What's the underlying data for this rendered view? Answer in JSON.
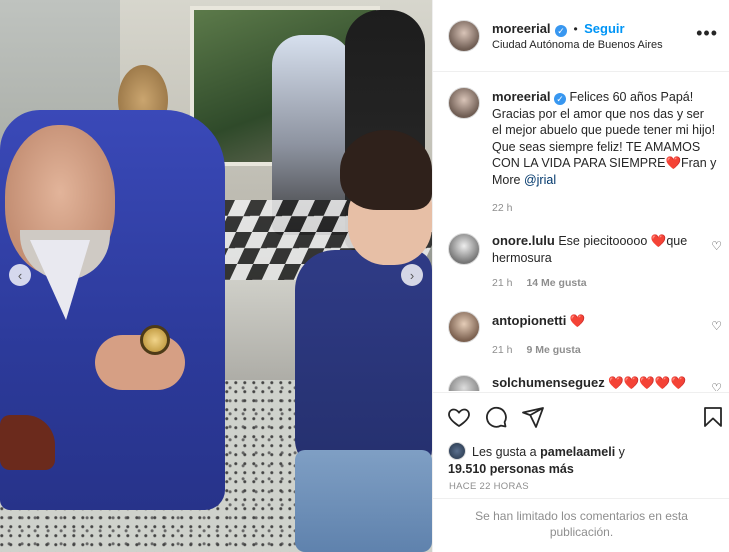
{
  "post": {
    "username": "moreerial",
    "follow_label": "Seguir",
    "location": "Ciudad Autónoma de Buenos Aires",
    "more_label": "•••"
  },
  "caption": {
    "username": "moreerial",
    "text": "Felices 60 años Papá! Gracias por el amor que nos das y ser el mejor abuelo que puede tener mi hijo! Que seas siempre feliz! TE AMAMOS CON LA VIDA PARA SIEMPRE❤️Fran y More",
    "mention": "@jrial",
    "time": "22 h"
  },
  "comments": [
    {
      "username": "onore.lulu",
      "text": "Ese piecitooooo ❤️que hermosura",
      "time": "21 h",
      "likes": "14 Me gusta"
    },
    {
      "username": "antopionetti",
      "text": "❤️",
      "time": "21 h",
      "likes": "9 Me gusta"
    },
    {
      "username": "solchumenseguez",
      "text": "❤️❤️❤️❤️❤️"
    }
  ],
  "likes": {
    "prefix": "Les gusta a",
    "user": "pamelaameli",
    "conj": "y",
    "count": "19.510 personas más"
  },
  "timestamp": "HACE 22 HORAS",
  "limited_notice": "Se han limitado los comentarios en esta publicación.",
  "carousel": {
    "prev_label": "‹",
    "next_label": "›"
  },
  "colors": {
    "link": "#0095f6",
    "verified": "#3897f0",
    "muted": "#8e8e8e"
  }
}
